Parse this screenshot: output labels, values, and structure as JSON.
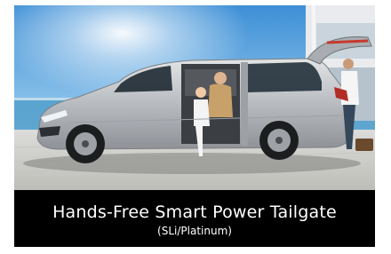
{
  "feature_card": {
    "caption_title": "Hands-Free Smart Power Tailgate",
    "caption_sub": "(SLi/Platinum)"
  },
  "colors": {
    "caption_bg": "#000000",
    "caption_text": "#ffffff",
    "sky_top": "#3d8fd6",
    "sea": "#4d9cc9",
    "van_body": "#b8bcc0"
  }
}
